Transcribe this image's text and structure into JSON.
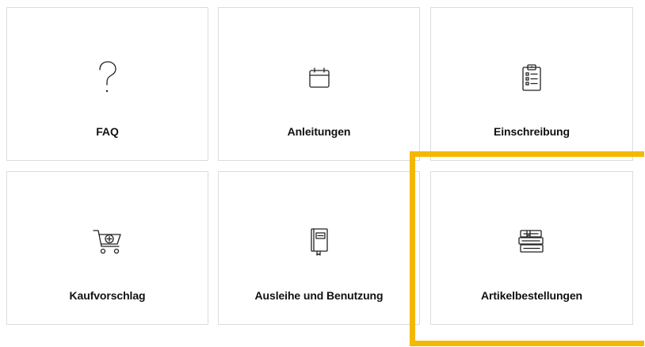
{
  "tiles": [
    {
      "label": "FAQ",
      "icon": "question-mark-icon"
    },
    {
      "label": "Anleitungen",
      "icon": "calendar-icon"
    },
    {
      "label": "Einschreibung",
      "icon": "clipboard-checklist-icon"
    },
    {
      "label": "Kaufvorschlag",
      "icon": "shopping-cart-plus-icon"
    },
    {
      "label": "Ausleihe und Benutzung",
      "icon": "book-icon"
    },
    {
      "label": "Artikelbestellungen",
      "icon": "book-stack-icon"
    }
  ],
  "colors": {
    "highlight": "#f5b800",
    "tile_border": "#dcdcdc",
    "text": "#111111",
    "icon": "#222222"
  }
}
